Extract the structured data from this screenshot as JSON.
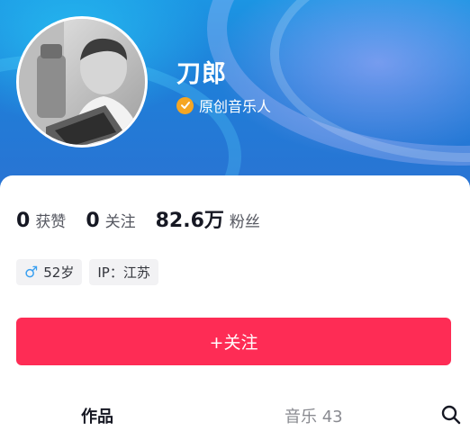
{
  "profile": {
    "name": "刀郎",
    "verification": "原创音乐人"
  },
  "stats": [
    {
      "value": "0",
      "label": "获赞"
    },
    {
      "value": "0",
      "label": "关注"
    },
    {
      "value": "82.6万",
      "label": "粉丝"
    }
  ],
  "tags": {
    "age": "52岁",
    "ip": "IP：江苏"
  },
  "actions": {
    "follow_label": "+关注"
  },
  "tabs": {
    "works": "作品",
    "music": "音乐 43"
  },
  "icons": {
    "gender": "male-icon",
    "verify": "verified-badge-icon",
    "search": "search-icon"
  },
  "colors": {
    "accent": "#fe2c55",
    "verify_badge": "#f5a623",
    "male": "#3aa0f0",
    "banner": "#1f7ed8"
  }
}
